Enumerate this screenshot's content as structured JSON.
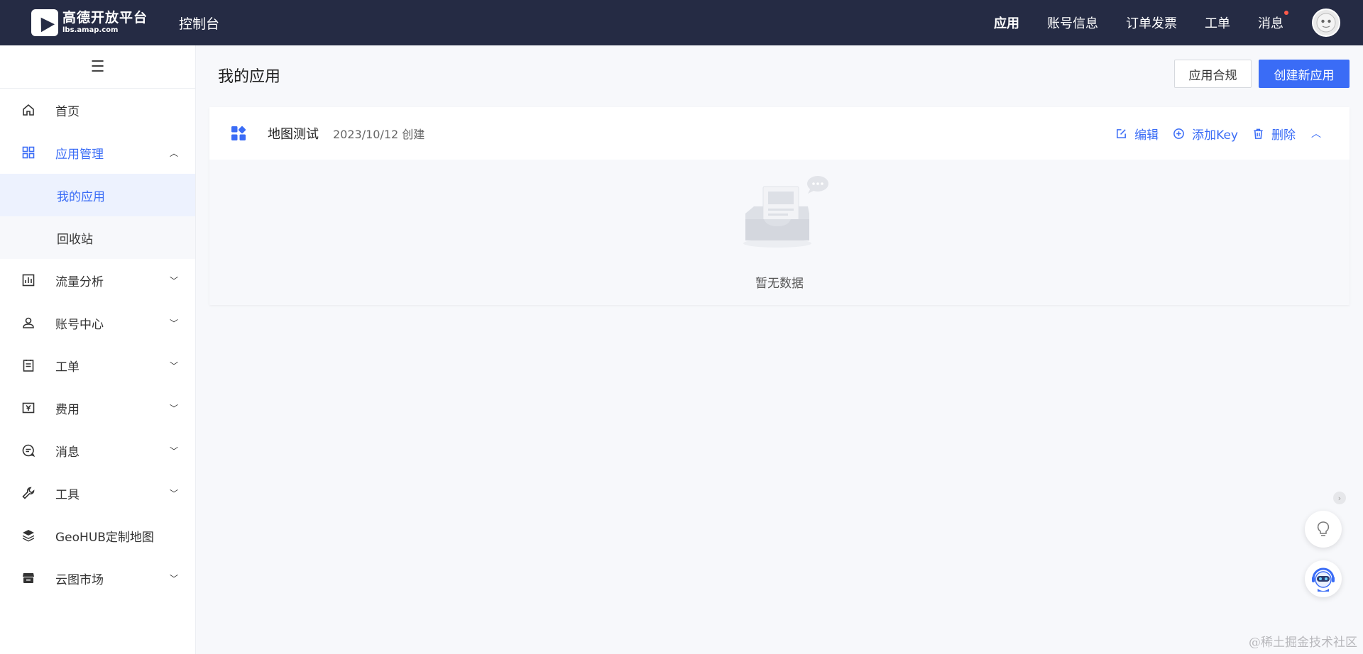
{
  "topbar": {
    "logo_name": "高德开放平台",
    "logo_url": "lbs.amap.com",
    "console_title": "控制台",
    "nav": [
      "应用",
      "账号信息",
      "订单发票",
      "工单",
      "消息"
    ]
  },
  "sidebar": {
    "toggle_icon": "menu-icon",
    "items": {
      "home": "首页",
      "app_manage": "应用管理",
      "my_apps": "我的应用",
      "recycle": "回收站",
      "traffic": "流量分析",
      "account": "账号中心",
      "ticket": "工单",
      "fee": "费用",
      "message": "消息",
      "tools": "工具",
      "geohub": "GeoHUB定制地图",
      "market": "云图市场"
    }
  },
  "main": {
    "page_title": "我的应用",
    "btn_compliance": "应用合规",
    "btn_create": "创建新应用",
    "app": {
      "name": "地图测试",
      "created": "2023/10/12 创建",
      "actions": {
        "edit": "编辑",
        "add_key": "添加Key",
        "delete": "删除"
      },
      "empty_text": "暂无数据"
    }
  },
  "watermark": "@稀土掘金技术社区",
  "colors": {
    "topbar": "#252b44",
    "primary": "#3a6cf6",
    "active_bg": "#edf2fe",
    "badge": "#ff5a4a"
  }
}
